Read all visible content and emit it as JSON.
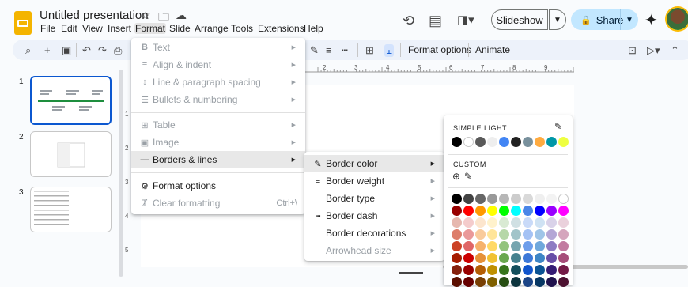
{
  "header": {
    "title": "Untitled presentation",
    "menus": [
      "File",
      "Edit",
      "View",
      "Insert",
      "Format",
      "Slide",
      "Arrange",
      "Tools",
      "Extensions",
      "Help"
    ],
    "slideshow": "Slideshow",
    "share": "Share"
  },
  "toolbar": {
    "format_options": "Format options",
    "animate": "Animate"
  },
  "ruler_numbers": [
    "2",
    "3",
    "4",
    "5",
    "6",
    "7",
    "8",
    "9"
  ],
  "slides": [
    "1",
    "2",
    "3"
  ],
  "format_menu": {
    "items": [
      {
        "label": "Text",
        "icon": "B",
        "disabled": true,
        "submenu": true
      },
      {
        "label": "Align & indent",
        "icon": "≡",
        "disabled": true,
        "submenu": true
      },
      {
        "label": "Line & paragraph spacing",
        "icon": "↕",
        "disabled": true,
        "submenu": true
      },
      {
        "label": "Bullets & numbering",
        "icon": "☰",
        "disabled": true,
        "submenu": true
      },
      {
        "label": "Table",
        "icon": "⊞",
        "disabled": true,
        "submenu": true
      },
      {
        "label": "Image",
        "icon": "▣",
        "disabled": true,
        "submenu": true
      },
      {
        "label": "Borders & lines",
        "icon": "—",
        "disabled": false,
        "submenu": true
      },
      {
        "label": "Format options",
        "icon": "⚙",
        "disabled": false,
        "submenu": false
      },
      {
        "label": "Clear formatting",
        "icon": "Ⱦ",
        "disabled": true,
        "submenu": false,
        "shortcut": "Ctrl+\\"
      }
    ]
  },
  "borders_menu": {
    "items": [
      {
        "label": "Border color",
        "icon": "✎",
        "disabled": false
      },
      {
        "label": "Border weight",
        "icon": "≡",
        "disabled": false
      },
      {
        "label": "Border type",
        "icon": "",
        "disabled": false
      },
      {
        "label": "Border dash",
        "icon": "┅",
        "disabled": false
      },
      {
        "label": "Border decorations",
        "icon": "",
        "disabled": false
      },
      {
        "label": "Arrowhead size",
        "icon": "",
        "disabled": true
      }
    ]
  },
  "color_panel": {
    "theme_label": "SIMPLE LIGHT",
    "custom_label": "CUSTOM",
    "theme_colors": [
      "#000000",
      "#ffffff",
      "#595959",
      "#eeeeee",
      "#4285f4",
      "#212121",
      "#78909c",
      "#ffab40",
      "#0097a7",
      "#eeff41"
    ],
    "grid_rows": [
      [
        "#000000",
        "#434343",
        "#666666",
        "#999999",
        "#b7b7b7",
        "#cccccc",
        "#d9d9d9",
        "#efefef",
        "#f3f3f3",
        "#ffffff"
      ],
      [
        "#980000",
        "#ff0000",
        "#ff9900",
        "#ffff00",
        "#00ff00",
        "#00ffff",
        "#4a86e8",
        "#0000ff",
        "#9900ff",
        "#ff00ff"
      ],
      [
        "#e6b8af",
        "#f4cccc",
        "#fce5cd",
        "#fff2cc",
        "#d9ead3",
        "#d0e0e3",
        "#c9daf8",
        "#cfe2f3",
        "#d9d2e9",
        "#ead1dc"
      ],
      [
        "#dd7e6b",
        "#ea9999",
        "#f9cb9c",
        "#ffe599",
        "#b6d7a8",
        "#a2c4c9",
        "#a4c2f4",
        "#9fc5e8",
        "#b4a7d6",
        "#d5a6bd"
      ],
      [
        "#cc4125",
        "#e06666",
        "#f6b26b",
        "#ffd966",
        "#93c47d",
        "#76a5af",
        "#6d9eeb",
        "#6fa8dc",
        "#8e7cc3",
        "#c27ba0"
      ],
      [
        "#a61c00",
        "#cc0000",
        "#e69138",
        "#f1c232",
        "#6aa84f",
        "#45818e",
        "#3c78d8",
        "#3d85c6",
        "#674ea7",
        "#a64d79"
      ],
      [
        "#85200c",
        "#990000",
        "#b45f06",
        "#bf9000",
        "#38761d",
        "#134f5c",
        "#1155cc",
        "#0b5394",
        "#351c75",
        "#741b47"
      ],
      [
        "#5b0f00",
        "#660000",
        "#783f04",
        "#7f6000",
        "#274e13",
        "#0c343d",
        "#1c4587",
        "#073763",
        "#20124d",
        "#4c1130"
      ]
    ]
  }
}
